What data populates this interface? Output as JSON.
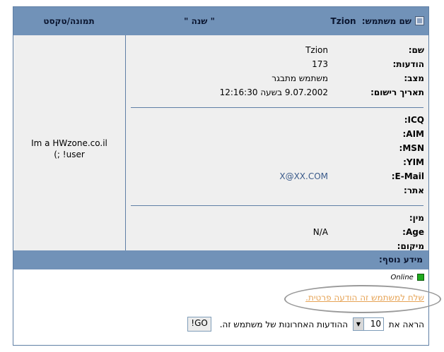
{
  "header": {
    "profile_label": "שם משתמש:",
    "username": "Tzion",
    "quote": "\" שנה \"",
    "picture_label": "תמונה/טקסט"
  },
  "avatar": {
    "line1": "Im a HWzone.co.il",
    "line2": "(; !user"
  },
  "details": {
    "name_label": "שם:",
    "name_value": "Tzion",
    "posts_label": "הודעות:",
    "posts_value": "173",
    "status_label": "מצב:",
    "status_value": "משתמש מתבגר",
    "registered_label": "תאריך רישום:",
    "registered_value": "9.07.2002 בשעה 12:16:30"
  },
  "contact": {
    "icq_label": "ICQ:",
    "aim_label": "AIM:",
    "msn_label": "MSN:",
    "yim_label": "YIM:",
    "email_label": "E-Mail:",
    "email_value": "X@XX.COM",
    "site_label": "אתר:"
  },
  "personal": {
    "gender_label": "מין:",
    "age_label": "Age:",
    "age_value": "N/A",
    "location_label": "מיקום:"
  },
  "extra": {
    "section_label": "מידע נוסף:",
    "online_text": "Online",
    "pm_link": "שלח למשתמש זה הודעה פרטית.",
    "show_text": "הראה את",
    "posts_count": "10",
    "posts_suffix": "ההודעות האחרונות של משתמש זה.",
    "go_label": "GO!"
  },
  "colors": {
    "header_bg": "#7192b8",
    "row_bg": "#efefef",
    "link": "#e6a355",
    "online": "#1faa1f"
  }
}
